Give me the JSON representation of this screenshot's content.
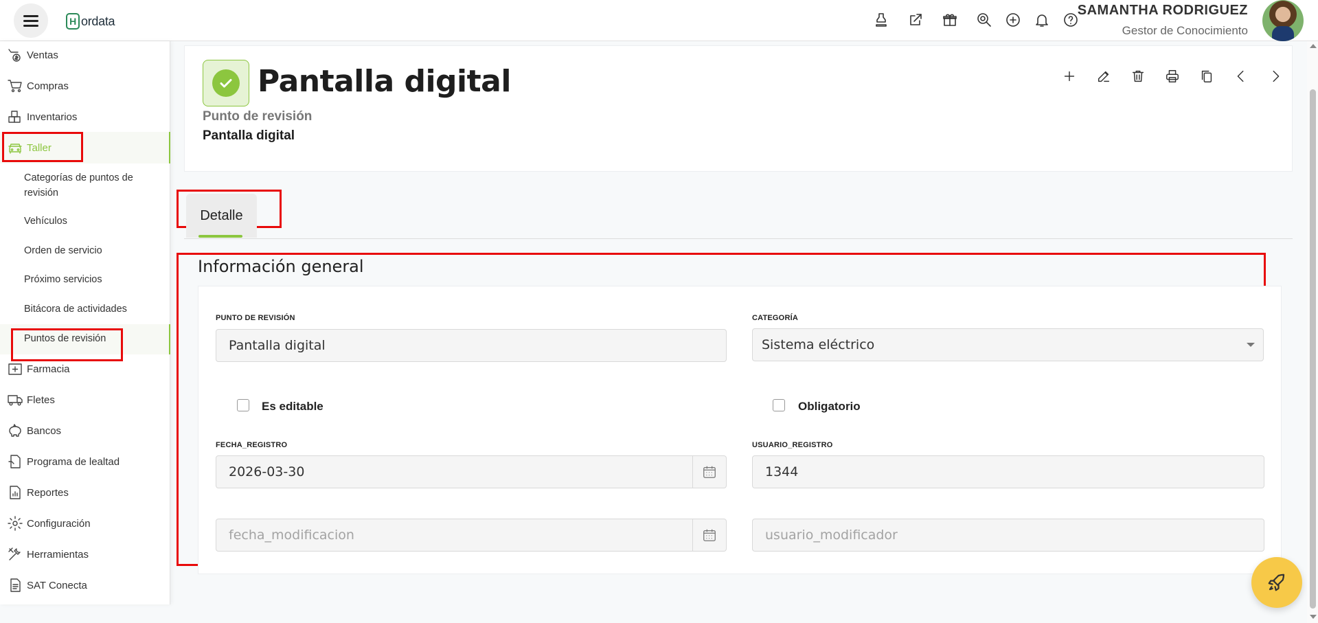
{
  "app": {
    "logo_text": "ordata",
    "logo_letter": "H"
  },
  "user": {
    "name": "SAMANTHA RODRIGUEZ",
    "role": "Gestor de Conocimiento"
  },
  "top_icons": [
    "stamp-icon",
    "external-link-icon",
    "gift-icon",
    "search-zoom-icon",
    "add-circle-icon",
    "bell-icon",
    "help-icon"
  ],
  "sidebar": {
    "items": [
      {
        "label": "Ventas",
        "icon": "sales-icon"
      },
      {
        "label": "Compras",
        "icon": "cart-icon"
      },
      {
        "label": "Inventarios",
        "icon": "boxes-icon"
      },
      {
        "label": "Taller",
        "icon": "car-icon",
        "active": true
      },
      {
        "label": "Farmacia",
        "icon": "pharmacy-icon"
      },
      {
        "label": "Fletes",
        "icon": "truck-icon"
      },
      {
        "label": "Bancos",
        "icon": "piggy-bank-icon"
      },
      {
        "label": "Programa de lealtad",
        "icon": "loyalty-icon"
      },
      {
        "label": "Reportes",
        "icon": "report-icon"
      },
      {
        "label": "Configuración",
        "icon": "gear-icon"
      },
      {
        "label": "Herramientas",
        "icon": "tools-icon"
      },
      {
        "label": "SAT Conecta",
        "icon": "document-icon"
      }
    ],
    "sub_items": [
      {
        "label": "Categorías de puntos de revisión"
      },
      {
        "label": "Vehículos"
      },
      {
        "label": "Orden de servicio"
      },
      {
        "label": "Próximo servicios"
      },
      {
        "label": "Bitácora de actividades"
      },
      {
        "label": "Puntos de revisión",
        "active": true
      }
    ]
  },
  "header": {
    "title": "Pantalla digital",
    "subtitle_label": "Punto de revisión",
    "subtitle_value": "Pantalla digital",
    "actions": [
      "add-icon",
      "edit-icon",
      "trash-icon",
      "print-icon",
      "copy-icon",
      "chevron-left-icon",
      "chevron-right-icon"
    ]
  },
  "tabs": [
    {
      "label": "Detalle",
      "active": true
    }
  ],
  "section": {
    "title": "Información general",
    "fields": {
      "punto_revision": {
        "label": "PUNTO DE REVISIÓN",
        "value": "Pantalla digital"
      },
      "categoria": {
        "label": "CATEGORÍA",
        "value": "Sistema eléctrico"
      },
      "es_editable": {
        "label": "Es editable",
        "checked": false
      },
      "obligatorio": {
        "label": "Obligatorio",
        "checked": false
      },
      "fecha_registro": {
        "label": "FECHA_REGISTRO",
        "value": "2026-03-30"
      },
      "usuario_registro": {
        "label": "USUARIO_REGISTRO",
        "value": "1344"
      },
      "fecha_modificacion": {
        "placeholder": "fecha_modificacion",
        "value": ""
      },
      "usuario_modificador": {
        "placeholder": "usuario_modificador",
        "value": ""
      }
    }
  },
  "colors": {
    "accent": "#8cc63f",
    "highlight_box": "#e80a0a",
    "fab": "#f7c948"
  }
}
